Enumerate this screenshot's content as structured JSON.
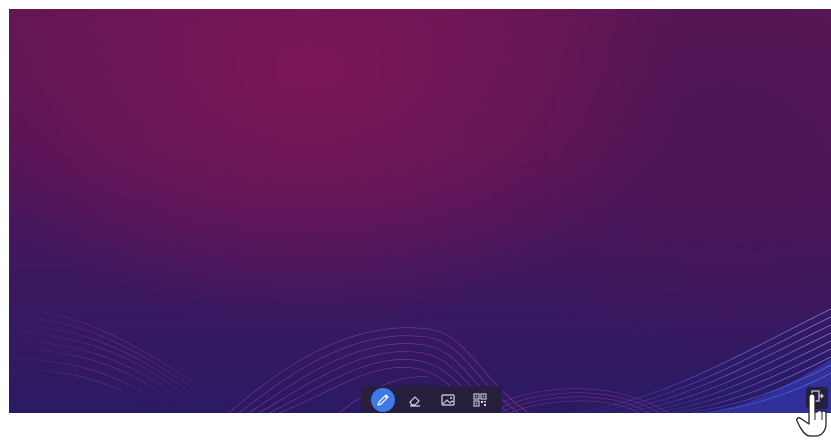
{
  "desktop": {
    "background": "purple-gradient-with-wave-lines",
    "colors": {
      "top": "#5e1654",
      "glow": "#7a1656",
      "bottom": "#2a1a62",
      "wave_pink": "#c23a9a",
      "wave_blue": "#3f6dff"
    }
  },
  "toolbar": {
    "tools": [
      {
        "icon": "pen-icon",
        "active": true
      },
      {
        "icon": "eraser-icon",
        "active": false
      },
      {
        "icon": "image-icon",
        "active": false
      },
      {
        "icon": "qr-code-icon",
        "active": false
      }
    ],
    "active_color": "#3d7be8"
  },
  "corner_button": {
    "icon": "exit-icon"
  },
  "pointer": {
    "icon": "hand-pointer-icon"
  }
}
